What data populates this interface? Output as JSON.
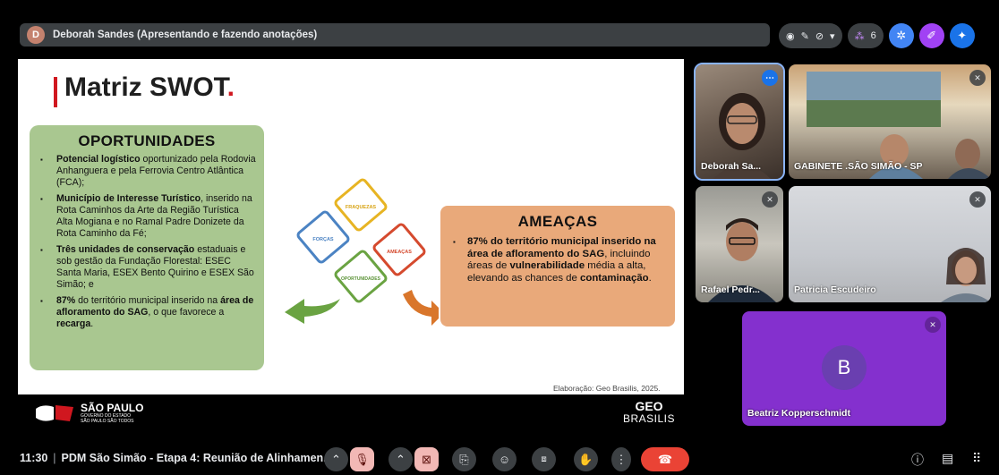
{
  "presenter_bar": {
    "avatar_letter": "D",
    "label": "Deborah Sandes (Apresentando e fazendo anotações)"
  },
  "top_controls": {
    "participants_count": "6"
  },
  "slide": {
    "title": "Matriz SWOT",
    "title_dot": ".",
    "oportunidades": {
      "heading": "OPORTUNIDADES",
      "items": [
        {
          "bold": "Potencial logístico",
          "rest": " oportunizado pela Rodovia Anhanguera e pela Ferrovia Centro Atlântica (FCA);"
        },
        {
          "bold": "Município de Interesse Turístico",
          "rest": ", inserido na Rota Caminhos da Arte da Região Turística Alta Mogiana e no Ramal Padre Donizete da Rota Caminho da Fé;"
        },
        {
          "bold": "Três unidades de conservação",
          "rest": " estaduais e sob gestão da Fundação Florestal: ESEC Santa Maria, ESEX Bento Quirino e ESEX São Simão; e"
        },
        {
          "bold": "87%",
          "rest": " do território municipal inserido na ",
          "bold2": "área de afloramento do SAG",
          "rest2": ", o que favorece a ",
          "bold3": "recarga",
          "rest3": "."
        }
      ]
    },
    "ameacas": {
      "heading": "AMEAÇAS",
      "bold1": "87% do território municipal inserido na área de afloramento do SAG",
      "text1": ", incluindo áreas de ",
      "bold2": "vulnerabilidade",
      "text2": " média a alta, elevando as chances de ",
      "bold3": "contaminação",
      "text3": "."
    },
    "puzzle_labels": {
      "fraquezas": "FRAQUEZAS",
      "forcas": "FORÇAS",
      "ameacas": "AMEAÇAS",
      "oportunidades": "OPORTUNIDADES"
    },
    "credit": "Elaboração: Geo Brasilis, 2025.",
    "footer": {
      "sp_main": "SÃO PAULO",
      "sp_sub1": "GOVERNO DO ESTADO",
      "sp_sub2": "SÃO PAULO SÃO TODOS",
      "geo_main": "GEO",
      "geo_sub": "BRASILIS"
    }
  },
  "participants": [
    {
      "name": "Deborah Sa...",
      "muted": false
    },
    {
      "name": "GABINETE .SÃO SIMÃO - SP",
      "muted": true
    },
    {
      "name": "Rafael Pedr...",
      "muted": true
    },
    {
      "name": "Patricia Escudeiro",
      "muted": true
    },
    {
      "name": "Beatriz Kopperschmidt",
      "initial": "B",
      "muted": true
    }
  ],
  "bottom_bar": {
    "time": "11:30",
    "meeting_title": "PDM São Simão - Etapa 4: Reunião de Alinhamen..."
  },
  "colors": {
    "opportunities_bg": "#a9c790",
    "threats_bg": "#e9a97a",
    "accent_red": "#d0171f",
    "tile_purple": "#8430ce",
    "end_call": "#ea4335"
  }
}
